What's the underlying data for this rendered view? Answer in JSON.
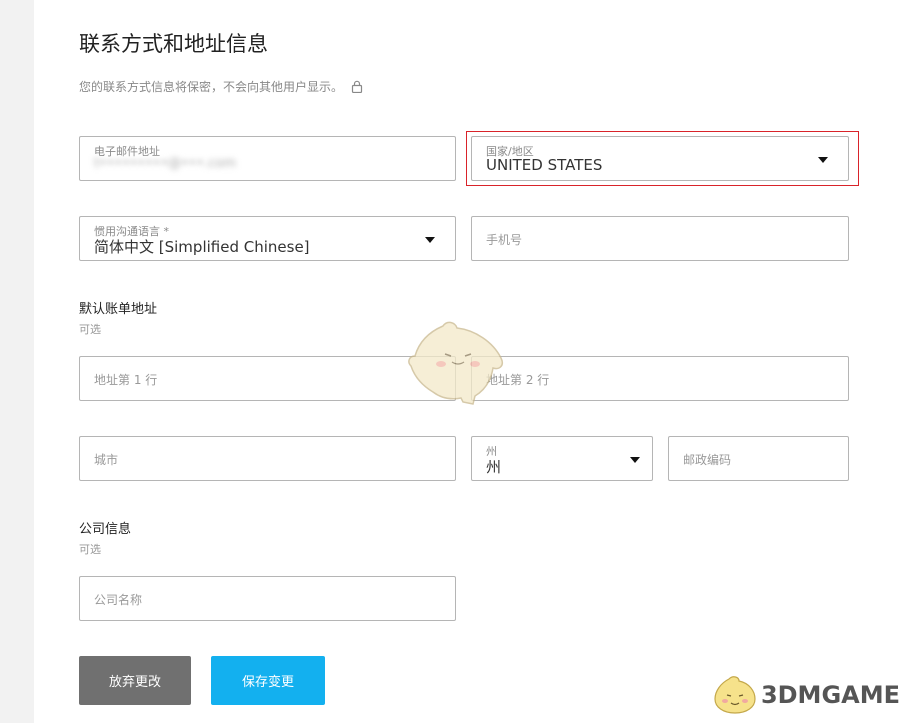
{
  "header": {
    "title": "联系方式和地址信息",
    "subtitle": "您的联系方式信息将保密，不会向其他用户显示。"
  },
  "contact": {
    "email_label": "电子邮件地址",
    "email_value": "t•••••••••@•••.com",
    "country_label": "国家/地区",
    "country_value": "UNITED STATES",
    "language_label": "惯用沟通语言 *",
    "language_value": "简体中文 [Simplified Chinese]",
    "phone_placeholder": "手机号"
  },
  "billing": {
    "title": "默认账单地址",
    "optional": "可选",
    "address1_placeholder": "地址第 1 行",
    "address2_placeholder": "地址第 2 行",
    "city_placeholder": "城市",
    "state_label": "州",
    "state_value": "州",
    "zip_placeholder": "邮政编码"
  },
  "company": {
    "title": "公司信息",
    "optional": "可选",
    "name_placeholder": "公司名称"
  },
  "actions": {
    "discard_label": "放弃更改",
    "save_label": "保存变更"
  },
  "watermark": {
    "text": "3DMGAME"
  },
  "colors": {
    "save_button": "#13b0ef",
    "discard_button": "#707070",
    "highlight_border": "#d9232a"
  }
}
